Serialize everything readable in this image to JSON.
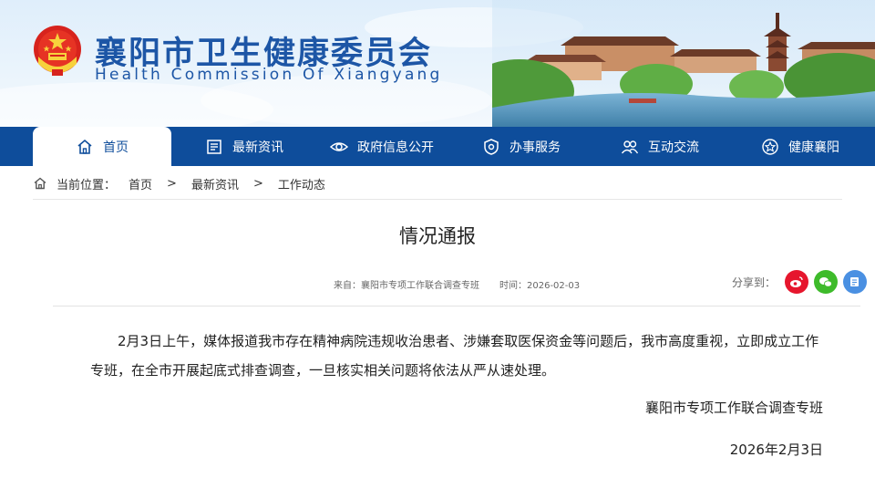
{
  "header": {
    "title_cn": "襄阳市卫生健康委员会",
    "title_en": "Health Commission Of Xiangyang"
  },
  "nav": {
    "items": [
      {
        "label": "首页",
        "icon": "home-icon",
        "active": true
      },
      {
        "label": "最新资讯",
        "icon": "news-icon",
        "active": false
      },
      {
        "label": "政府信息公开",
        "icon": "eye-icon",
        "active": false
      },
      {
        "label": "办事服务",
        "icon": "shield-icon",
        "active": false
      },
      {
        "label": "互动交流",
        "icon": "people-icon",
        "active": false
      },
      {
        "label": "健康襄阳",
        "icon": "star-icon",
        "active": false
      }
    ]
  },
  "breadcrumb": {
    "prefix": "当前位置：",
    "items": [
      "首页",
      "最新资讯",
      "工作动态"
    ],
    "separator": ">"
  },
  "article": {
    "title": "情况通报",
    "source": "来自：襄阳市专项工作联合调查专班",
    "time": "时间：2026-02-03",
    "share_label": "分享到：",
    "share_targets": [
      "weibo-icon",
      "wechat-icon",
      "qzone-icon"
    ],
    "body": "2月3日上午，媒体报道我市存在精神病院违规收治患者、涉嫌套取医保资金等问题后，我市高度重视，立即成立工作专班，在全市开展起底式排查调查，一旦核实相关问题将依法从严从速处理。",
    "signature": "襄阳市专项工作联合调查专班",
    "date": "2026年2月3日"
  },
  "colors": {
    "brand": "#0e4d9b",
    "title_blue": "#1d56a6",
    "weibo": "#e6162d",
    "wechat": "#3ebb2b",
    "qzone": "#4a90e2"
  }
}
